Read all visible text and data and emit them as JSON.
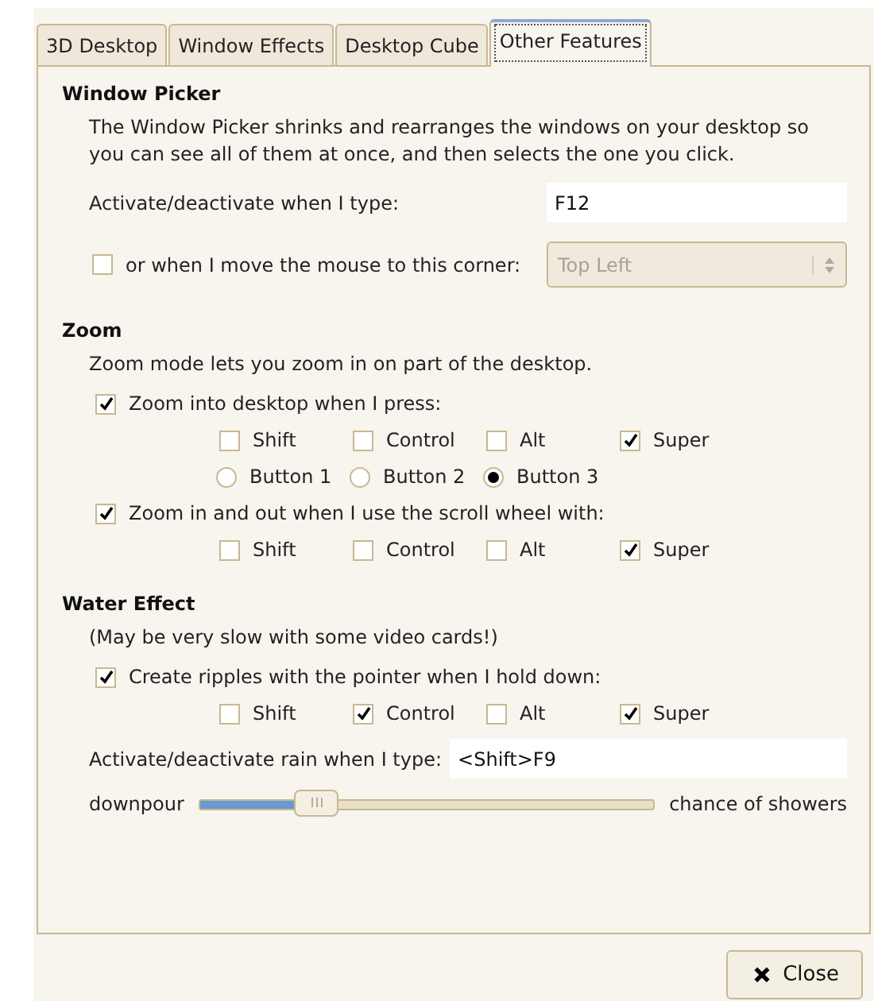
{
  "tabs": [
    {
      "label": "3D Desktop",
      "selected": false
    },
    {
      "label": "Window Effects",
      "selected": false
    },
    {
      "label": "Desktop Cube",
      "selected": false
    },
    {
      "label": "Other Features",
      "selected": true
    }
  ],
  "sections": [
    {
      "title": "Window Picker",
      "rows": [
        {
          "kind": "text",
          "text": "The Window Picker shrinks and rearranges the windows on your desktop so you can see all of them at once, and then selects the one you click."
        },
        {
          "kind": "form",
          "rows": [
            {
              "kind": "key",
              "label": "Activate/deactivate when I type:",
              "value": "F12"
            },
            {
              "kind": "corner",
              "label": "or when I move the mouse to this corner:",
              "checked": false,
              "value": "Top Left",
              "disabled": true
            }
          ]
        }
      ]
    },
    {
      "title": "Zoom",
      "rows": [
        {
          "kind": "text",
          "text": "Zoom mode lets you zoom in on part of the desktop."
        },
        {
          "kind": "check",
          "label": "Zoom into desktop when I press:",
          "checked": true
        },
        {
          "kind": "modifiers",
          "items": [
            {
              "label": "Shift",
              "checked": false
            },
            {
              "label": "Control",
              "checked": false
            },
            {
              "label": "Alt",
              "checked": false
            },
            {
              "label": "Super",
              "checked": true
            }
          ]
        },
        {
          "kind": "radios",
          "items": [
            {
              "label": "Button 1",
              "selected": false
            },
            {
              "label": "Button 2",
              "selected": false
            },
            {
              "label": "Button 3",
              "selected": true
            }
          ]
        },
        {
          "kind": "check",
          "label": "Zoom in and out when I use the scroll wheel with:",
          "checked": true
        },
        {
          "kind": "modifiers",
          "items": [
            {
              "label": "Shift",
              "checked": false
            },
            {
              "label": "Control",
              "checked": false
            },
            {
              "label": "Alt",
              "checked": false
            },
            {
              "label": "Super",
              "checked": true
            }
          ]
        }
      ]
    },
    {
      "title": "Water Effect",
      "rows": [
        {
          "kind": "text",
          "text": "(May be very slow with some video cards!)"
        },
        {
          "kind": "check",
          "label": "Create ripples with the pointer when I hold down:",
          "checked": true
        },
        {
          "kind": "modifiers",
          "items": [
            {
              "label": "Shift",
              "checked": false
            },
            {
              "label": "Control",
              "checked": true
            },
            {
              "label": "Alt",
              "checked": false
            },
            {
              "label": "Super",
              "checked": true
            }
          ]
        },
        {
          "kind": "key",
          "label": "Activate/deactivate rain when I type:",
          "value": "<Shift>F9"
        },
        {
          "kind": "slider",
          "left": "downpour",
          "right": "chance of showers",
          "level": 0.26
        }
      ]
    }
  ],
  "close_button": {
    "label": "Close"
  }
}
